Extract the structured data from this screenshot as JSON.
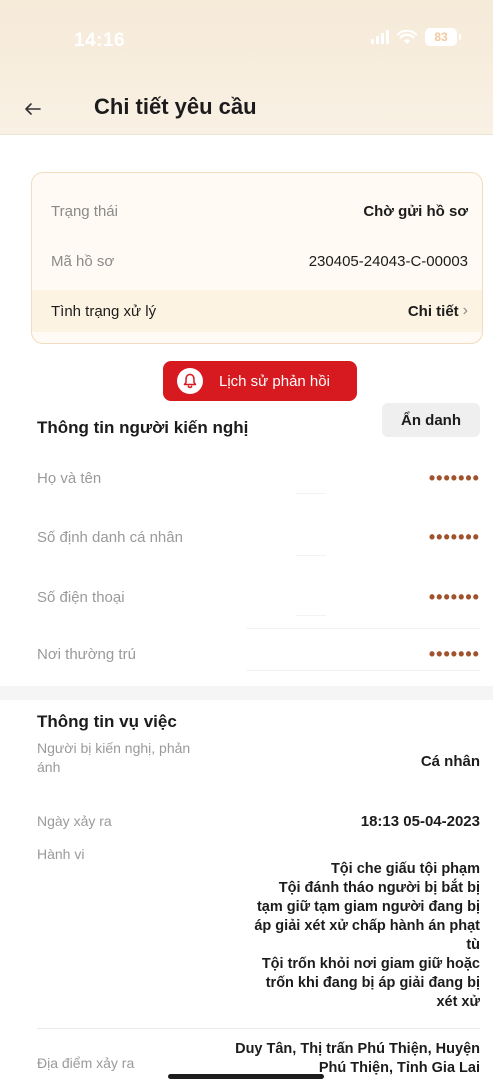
{
  "status_bar": {
    "time": "14:16",
    "battery": "83"
  },
  "header": {
    "title": "Chi tiết yêu cầu"
  },
  "status_card": {
    "rows": [
      {
        "label": "Trạng thái",
        "value": "Chờ gửi hồ sơ"
      },
      {
        "label": "Mã hồ sơ",
        "value": "230405-24043-C-00003"
      },
      {
        "label": "Tình trạng xử lý",
        "value": "Chi tiết"
      }
    ]
  },
  "history_button": {
    "label": "Lịch sử phản hồi"
  },
  "petitioner": {
    "title": "Thông tin người kiến nghị",
    "anon_label": "Ẩn danh",
    "fields": [
      {
        "label": "Họ và tên",
        "value": "•••••••"
      },
      {
        "label": "Số định danh cá nhân",
        "value": "•••••••"
      },
      {
        "label": "Số điện thoại",
        "value": "•••••••"
      },
      {
        "label": "Nơi thường trú",
        "value": "•••••••"
      }
    ]
  },
  "case": {
    "title": "Thông tin vụ việc",
    "rows": [
      {
        "label": "Người bị kiến nghị, phản ánh",
        "value": "Cá nhân"
      },
      {
        "label": "Ngày xảy ra",
        "value": "18:13 05-04-2023"
      },
      {
        "label": "Hành vi",
        "value": ""
      },
      {
        "label": "Địa điểm xảy ra",
        "value": "Duy Tân, Thị trấn Phú Thiện, Huyện Phú Thiện, Tỉnh Gia Lai"
      }
    ],
    "behaviors": [
      "Tội che giấu tội phạm",
      "Tội đánh tháo người bị bắt bị tạm giữ tạm giam người đang bị áp giải xét xử chấp hành án phạt tù",
      "Tội trốn khỏi nơi giam giữ hoặc trốn khi đang bị áp giải đang bị xét xử"
    ]
  },
  "colors": {
    "accent_red": "#d71920",
    "header_bg": "#f6ead8",
    "masked": "#a0522d"
  }
}
